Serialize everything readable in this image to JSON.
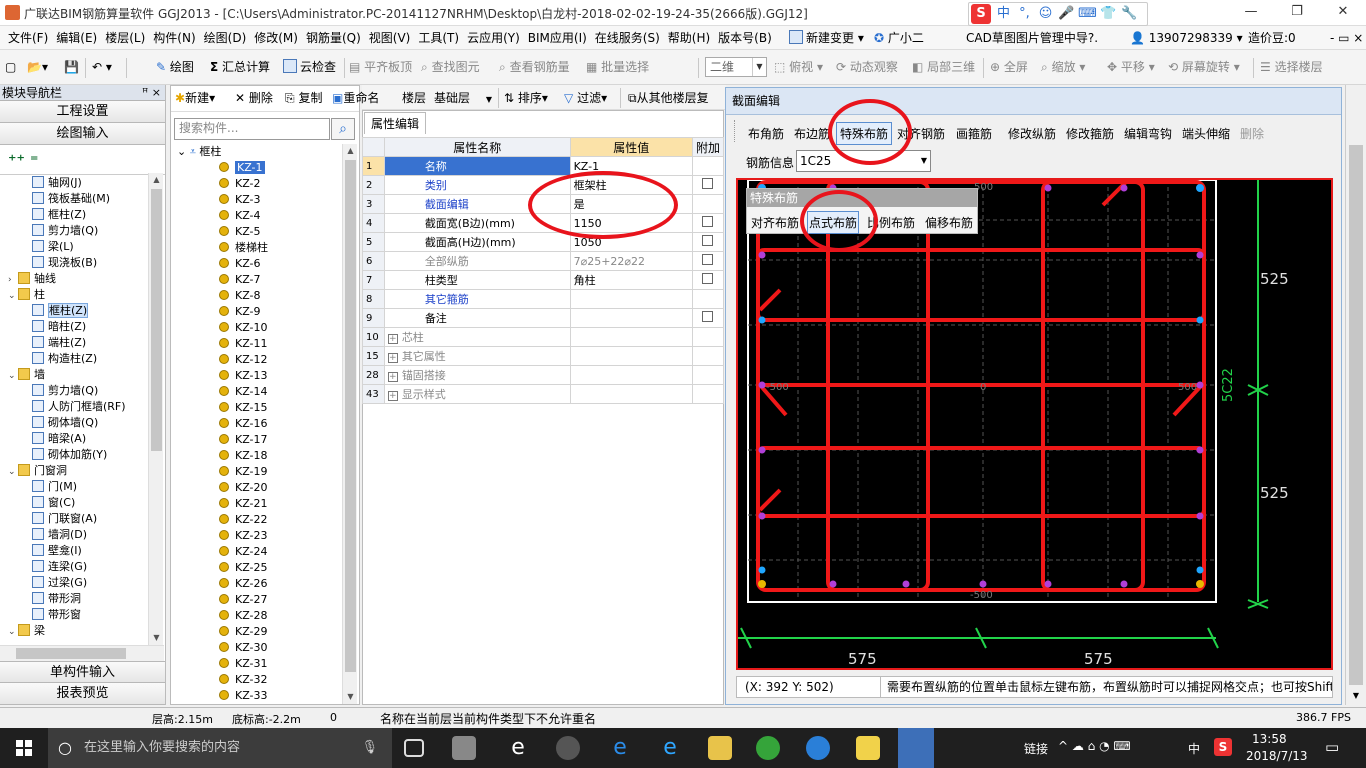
{
  "window": {
    "title": "广联达BIM钢筋算量软件 GGJ2013 - [C:\\Users\\Administrator.PC-20141127NRHM\\Desktop\\白龙村-2018-02-02-19-24-35(2666版).GGJ12]",
    "ime": [
      "中",
      "°,",
      "☺",
      "🎤",
      "⌨",
      "👕",
      "🔧"
    ]
  },
  "menubar": {
    "items": [
      "文件(F)",
      "编辑(E)",
      "楼层(L)",
      "构件(N)",
      "绘图(D)",
      "修改(M)",
      "钢筋量(Q)",
      "视图(V)",
      "工具(T)",
      "云应用(Y)",
      "BIM应用(I)",
      "在线服务(S)",
      "帮助(H)",
      "版本号(B)"
    ],
    "new_change": "新建变更",
    "assistant": "广小二",
    "cad_manage": "CAD草图图片管理中导?.",
    "phone": "13907298339",
    "price_bean": "造价豆:0"
  },
  "toolbar": {
    "draw": "绘图",
    "sum_calc": "汇总计算",
    "cloud_check": "云检查",
    "align_top": "平齐板顶",
    "find_element": "查找图元",
    "view_rebar": "查看钢筋量",
    "batch_select": "批量选择",
    "view_mode": "二维",
    "top_view": "俯视",
    "dynamic_view": "动态观察",
    "local_3d": "局部三维",
    "fullscreen": "全屏",
    "zoom": "缩放",
    "pan": "平移",
    "rotate": "屏幕旋转",
    "select_floor": "选择楼层"
  },
  "nav": {
    "header": "模块导航栏",
    "pins": "ꟸ ×",
    "project_settings": "工程设置",
    "draw_input": "绘图输入",
    "single_input": "单构件输入",
    "report_preview": "报表预览",
    "tree": [
      {
        "label": "轴网(J)",
        "indent": 2,
        "toggle": ""
      },
      {
        "label": "筏板基础(M)",
        "indent": 2,
        "toggle": ""
      },
      {
        "label": "框柱(Z)",
        "indent": 2,
        "toggle": ""
      },
      {
        "label": "剪力墙(Q)",
        "indent": 2,
        "toggle": ""
      },
      {
        "label": "梁(L)",
        "indent": 2,
        "toggle": ""
      },
      {
        "label": "现浇板(B)",
        "indent": 2,
        "toggle": ""
      },
      {
        "label": "轴线",
        "indent": 1,
        "toggle": "›",
        "folder": true
      },
      {
        "label": "柱",
        "indent": 1,
        "toggle": "⌄",
        "folder": true
      },
      {
        "label": "框柱(Z)",
        "indent": 2,
        "toggle": "",
        "selected": true
      },
      {
        "label": "暗柱(Z)",
        "indent": 2,
        "toggle": ""
      },
      {
        "label": "端柱(Z)",
        "indent": 2,
        "toggle": ""
      },
      {
        "label": "构造柱(Z)",
        "indent": 2,
        "toggle": ""
      },
      {
        "label": "墙",
        "indent": 1,
        "toggle": "⌄",
        "folder": true
      },
      {
        "label": "剪力墙(Q)",
        "indent": 2,
        "toggle": ""
      },
      {
        "label": "人防门框墙(RF)",
        "indent": 2,
        "toggle": ""
      },
      {
        "label": "砌体墙(Q)",
        "indent": 2,
        "toggle": ""
      },
      {
        "label": "暗梁(A)",
        "indent": 2,
        "toggle": ""
      },
      {
        "label": "砌体加筋(Y)",
        "indent": 2,
        "toggle": ""
      },
      {
        "label": "门窗洞",
        "indent": 1,
        "toggle": "⌄",
        "folder": true
      },
      {
        "label": "门(M)",
        "indent": 2,
        "toggle": ""
      },
      {
        "label": "窗(C)",
        "indent": 2,
        "toggle": ""
      },
      {
        "label": "门联窗(A)",
        "indent": 2,
        "toggle": ""
      },
      {
        "label": "墙洞(D)",
        "indent": 2,
        "toggle": ""
      },
      {
        "label": "壁龛(I)",
        "indent": 2,
        "toggle": ""
      },
      {
        "label": "连梁(G)",
        "indent": 2,
        "toggle": ""
      },
      {
        "label": "过梁(G)",
        "indent": 2,
        "toggle": ""
      },
      {
        "label": "带形洞",
        "indent": 2,
        "toggle": ""
      },
      {
        "label": "带形窗",
        "indent": 2,
        "toggle": ""
      },
      {
        "label": "梁",
        "indent": 1,
        "toggle": "⌄",
        "folder": true
      }
    ]
  },
  "components": {
    "new": "新建",
    "delete": "删除",
    "copy": "复制",
    "rename": "重命名",
    "floor_label": "楼层",
    "floor_value": "基础层",
    "sort": "排序",
    "filter": "过滤",
    "copy_from_floor": "从其他楼层复",
    "search_placeholder": "搜索构件...",
    "root": "框柱",
    "items": [
      "KZ-1",
      "KZ-2",
      "KZ-3",
      "KZ-4",
      "KZ-5",
      "楼梯柱",
      "KZ-6",
      "KZ-7",
      "KZ-8",
      "KZ-9",
      "KZ-10",
      "KZ-11",
      "KZ-12",
      "KZ-13",
      "KZ-14",
      "KZ-15",
      "KZ-16",
      "KZ-17",
      "KZ-18",
      "KZ-19",
      "KZ-20",
      "KZ-21",
      "KZ-22",
      "KZ-23",
      "KZ-24",
      "KZ-25",
      "KZ-26",
      "KZ-27",
      "KZ-28",
      "KZ-29",
      "KZ-30",
      "KZ-31",
      "KZ-32",
      "KZ-33"
    ]
  },
  "props": {
    "tab": "属性编辑",
    "col_name": "属性名称",
    "col_value": "属性值",
    "col_extra": "附加",
    "rows": [
      {
        "no": "1",
        "name": "名称",
        "value": "KZ-1",
        "style": "blue",
        "check": false,
        "expand": false
      },
      {
        "no": "2",
        "name": "类别",
        "value": "框架柱",
        "style": "blue",
        "check": true,
        "expand": false
      },
      {
        "no": "3",
        "name": "截面编辑",
        "value": "是",
        "style": "blue",
        "check": false,
        "expand": false
      },
      {
        "no": "4",
        "name": "截面宽(B边)(mm)",
        "value": "1150",
        "style": "",
        "check": true,
        "expand": false
      },
      {
        "no": "5",
        "name": "截面高(H边)(mm)",
        "value": "1050",
        "style": "",
        "check": true,
        "expand": false
      },
      {
        "no": "6",
        "name": "全部纵筋",
        "value": "7⌀25+22⌀22",
        "style": "gray",
        "check": true,
        "expand": false
      },
      {
        "no": "7",
        "name": "柱类型",
        "value": "角柱",
        "style": "",
        "check": true,
        "expand": false
      },
      {
        "no": "8",
        "name": "其它箍筋",
        "value": "",
        "style": "blue",
        "check": false,
        "expand": false
      },
      {
        "no": "9",
        "name": "备注",
        "value": "",
        "style": "",
        "check": true,
        "expand": false
      },
      {
        "no": "10",
        "name": "芯柱",
        "value": "",
        "style": "gray",
        "check": false,
        "expand": true
      },
      {
        "no": "15",
        "name": "其它属性",
        "value": "",
        "style": "gray",
        "check": false,
        "expand": true
      },
      {
        "no": "28",
        "name": "锚固搭接",
        "value": "",
        "style": "gray",
        "check": false,
        "expand": true
      },
      {
        "no": "43",
        "name": "显示样式",
        "value": "",
        "style": "gray",
        "check": false,
        "expand": true
      }
    ]
  },
  "section_editor": {
    "title": "截面编辑",
    "buttons": [
      "布角筋",
      "布边筋",
      "特殊布筋",
      "对齐钢筋",
      "画箍筋",
      "修改纵筋",
      "修改箍筋",
      "编辑弯钩",
      "端头伸缩",
      "删除"
    ],
    "rebar_info_label": "钢筋信息",
    "rebar_info_value": "1C25",
    "popup_title": "特殊布筋",
    "popup_items": [
      "对齐布筋",
      "点式布筋",
      "比例布筋",
      "偏移布筋"
    ],
    "dim_top": "525",
    "dim_bottom": "525",
    "dim_side_label": "5C22",
    "dim_left": "575",
    "dim_right": "575",
    "axis_label_left": "-500",
    "axis_label_center": "0",
    "axis_label_right": "500",
    "axis_label_top": "500",
    "axis_label_bottom": "-500",
    "coord": "(X: 392 Y: 502)",
    "message": "需要布置纵筋的位置单击鼠标左键布筋，布置纵筋时可以捕捉网格交点；也可按Shift"
  },
  "statusbar": {
    "floor_height": "层高:2.15m",
    "base_height": "底标高:-2.2m",
    "zero": "0",
    "message": "名称在当前层当前构件类型下不允许重名",
    "fps": "386.7 FPS"
  },
  "taskbar": {
    "search_placeholder": "在这里输入你要搜索的内容",
    "link": "链接",
    "lang": "中",
    "time": "13:58",
    "date": "2018/7/13"
  },
  "colors": {
    "annotation_red": "#e8141c",
    "rebar_red": "#f01818",
    "dimension_green": "#22d34a",
    "selection_blue": "#3872d0",
    "header_value": "#fbe2a8"
  }
}
